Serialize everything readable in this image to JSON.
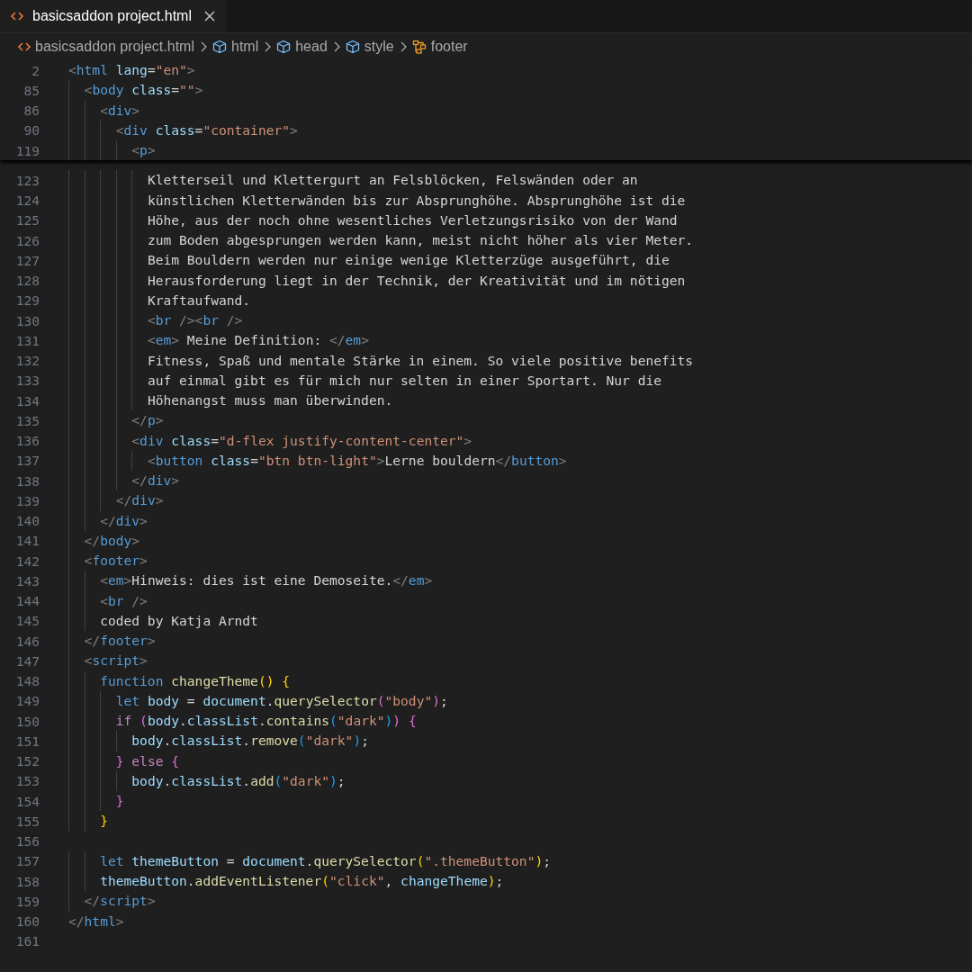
{
  "tabs": [
    {
      "label": "basicsaddon project.html",
      "selected": true
    }
  ],
  "breadcrumbs": [
    {
      "kind": "file",
      "label": "basicsaddon project.html"
    },
    {
      "kind": "element",
      "label": "html"
    },
    {
      "kind": "element",
      "label": "head"
    },
    {
      "kind": "element",
      "label": "style"
    },
    {
      "kind": "structure",
      "label": "footer"
    }
  ],
  "sticky_lines": [
    {
      "number": "2",
      "tokens": [
        {
          "kind": "punct",
          "text": "<"
        },
        {
          "kind": "tag",
          "text": "html"
        },
        {
          "kind": "attr",
          "text": " lang"
        },
        {
          "kind": "plain",
          "text": "="
        },
        {
          "kind": "string",
          "text": "\"en\""
        },
        {
          "kind": "punct",
          "text": ">"
        }
      ]
    },
    {
      "number": "85",
      "tokens": [
        {
          "kind": "punct",
          "text": "  <"
        },
        {
          "kind": "tag",
          "text": "body"
        },
        {
          "kind": "attr",
          "text": " class"
        },
        {
          "kind": "plain",
          "text": "="
        },
        {
          "kind": "string",
          "text": "\"\""
        },
        {
          "kind": "punct",
          "text": ">"
        }
      ]
    },
    {
      "number": "86",
      "tokens": [
        {
          "kind": "punct",
          "text": "    <"
        },
        {
          "kind": "tag",
          "text": "div"
        },
        {
          "kind": "punct",
          "text": ">"
        }
      ]
    },
    {
      "number": "90",
      "tokens": [
        {
          "kind": "punct",
          "text": "      <"
        },
        {
          "kind": "tag",
          "text": "div"
        },
        {
          "kind": "attr",
          "text": " class"
        },
        {
          "kind": "plain",
          "text": "="
        },
        {
          "kind": "string",
          "text": "\"container\""
        },
        {
          "kind": "punct",
          "text": ">"
        }
      ]
    },
    {
      "number": "119",
      "tokens": [
        {
          "kind": "punct",
          "text": "        <"
        },
        {
          "kind": "tag",
          "text": "p"
        },
        {
          "kind": "punct",
          "text": ">"
        }
      ]
    }
  ],
  "lines": [
    {
      "number": "123",
      "tokens": [
        {
          "kind": "plain",
          "text": "          Kletterseil und Klettergurt an Felsblöcken, Felswänden oder an"
        }
      ]
    },
    {
      "number": "124",
      "tokens": [
        {
          "kind": "plain",
          "text": "          künstlichen Kletterwänden bis zur Absprunghöhe. Absprunghöhe ist die"
        }
      ]
    },
    {
      "number": "125",
      "tokens": [
        {
          "kind": "plain",
          "text": "          Höhe, aus der noch ohne wesentliches Verletzungsrisiko von der Wand"
        }
      ]
    },
    {
      "number": "126",
      "tokens": [
        {
          "kind": "plain",
          "text": "          zum Boden abgesprungen werden kann, meist nicht höher als vier Meter."
        }
      ]
    },
    {
      "number": "127",
      "tokens": [
        {
          "kind": "plain",
          "text": "          Beim Bouldern werden nur einige wenige Kletterzüge ausgeführt, die"
        }
      ]
    },
    {
      "number": "128",
      "tokens": [
        {
          "kind": "plain",
          "text": "          Herausforderung liegt in der Technik, der Kreativität und im nötigen"
        }
      ]
    },
    {
      "number": "129",
      "tokens": [
        {
          "kind": "plain",
          "text": "          Kraftaufwand."
        }
      ]
    },
    {
      "number": "130",
      "tokens": [
        {
          "kind": "punct",
          "text": "          <"
        },
        {
          "kind": "tag",
          "text": "br"
        },
        {
          "kind": "punct",
          "text": " /><"
        },
        {
          "kind": "tag",
          "text": "br"
        },
        {
          "kind": "punct",
          "text": " />"
        }
      ]
    },
    {
      "number": "131",
      "tokens": [
        {
          "kind": "punct",
          "text": "          <"
        },
        {
          "kind": "tag",
          "text": "em"
        },
        {
          "kind": "punct",
          "text": ">"
        },
        {
          "kind": "plain",
          "text": " Meine Definition: "
        },
        {
          "kind": "punct",
          "text": "</"
        },
        {
          "kind": "tag",
          "text": "em"
        },
        {
          "kind": "punct",
          "text": ">"
        }
      ]
    },
    {
      "number": "132",
      "tokens": [
        {
          "kind": "plain",
          "text": "          Fitness, Spaß und mentale Stärke in einem. So viele positive benefits"
        }
      ]
    },
    {
      "number": "133",
      "tokens": [
        {
          "kind": "plain",
          "text": "          auf einmal gibt es für mich nur selten in einer Sportart. Nur die"
        }
      ]
    },
    {
      "number": "134",
      "tokens": [
        {
          "kind": "plain",
          "text": "          Höhenangst muss man überwinden."
        }
      ]
    },
    {
      "number": "135",
      "tokens": [
        {
          "kind": "punct",
          "text": "        </"
        },
        {
          "kind": "tag",
          "text": "p"
        },
        {
          "kind": "punct",
          "text": ">"
        }
      ]
    },
    {
      "number": "136",
      "tokens": [
        {
          "kind": "punct",
          "text": "        <"
        },
        {
          "kind": "tag",
          "text": "div"
        },
        {
          "kind": "attr",
          "text": " class"
        },
        {
          "kind": "plain",
          "text": "="
        },
        {
          "kind": "string",
          "text": "\"d-flex justify-content-center\""
        },
        {
          "kind": "punct",
          "text": ">"
        }
      ]
    },
    {
      "number": "137",
      "tokens": [
        {
          "kind": "punct",
          "text": "          <"
        },
        {
          "kind": "tag",
          "text": "button"
        },
        {
          "kind": "attr",
          "text": " class"
        },
        {
          "kind": "plain",
          "text": "="
        },
        {
          "kind": "string",
          "text": "\"btn btn-light\""
        },
        {
          "kind": "punct",
          "text": ">"
        },
        {
          "kind": "plain",
          "text": "Lerne bouldern"
        },
        {
          "kind": "punct",
          "text": "</"
        },
        {
          "kind": "tag",
          "text": "button"
        },
        {
          "kind": "punct",
          "text": ">"
        }
      ]
    },
    {
      "number": "138",
      "tokens": [
        {
          "kind": "punct",
          "text": "        </"
        },
        {
          "kind": "tag",
          "text": "div"
        },
        {
          "kind": "punct",
          "text": ">"
        }
      ]
    },
    {
      "number": "139",
      "tokens": [
        {
          "kind": "punct",
          "text": "      </"
        },
        {
          "kind": "tag",
          "text": "div"
        },
        {
          "kind": "punct",
          "text": ">"
        }
      ]
    },
    {
      "number": "140",
      "tokens": [
        {
          "kind": "punct",
          "text": "    </"
        },
        {
          "kind": "tag",
          "text": "div"
        },
        {
          "kind": "punct",
          "text": ">"
        }
      ]
    },
    {
      "number": "141",
      "tokens": [
        {
          "kind": "punct",
          "text": "  </"
        },
        {
          "kind": "tag",
          "text": "body"
        },
        {
          "kind": "punct",
          "text": ">"
        }
      ]
    },
    {
      "number": "142",
      "tokens": [
        {
          "kind": "punct",
          "text": "  <"
        },
        {
          "kind": "tag",
          "text": "footer"
        },
        {
          "kind": "punct",
          "text": ">"
        }
      ]
    },
    {
      "number": "143",
      "tokens": [
        {
          "kind": "punct",
          "text": "    <"
        },
        {
          "kind": "tag",
          "text": "em"
        },
        {
          "kind": "punct",
          "text": ">"
        },
        {
          "kind": "plain",
          "text": "Hinweis: dies ist eine Demoseite."
        },
        {
          "kind": "punct",
          "text": "</"
        },
        {
          "kind": "tag",
          "text": "em"
        },
        {
          "kind": "punct",
          "text": ">"
        }
      ]
    },
    {
      "number": "144",
      "tokens": [
        {
          "kind": "punct",
          "text": "    <"
        },
        {
          "kind": "tag",
          "text": "br"
        },
        {
          "kind": "punct",
          "text": " />"
        }
      ]
    },
    {
      "number": "145",
      "tokens": [
        {
          "kind": "plain",
          "text": "    coded by Katja Arndt"
        }
      ]
    },
    {
      "number": "146",
      "tokens": [
        {
          "kind": "punct",
          "text": "  </"
        },
        {
          "kind": "tag",
          "text": "footer"
        },
        {
          "kind": "punct",
          "text": ">"
        }
      ]
    },
    {
      "number": "147",
      "tokens": [
        {
          "kind": "punct",
          "text": "  <"
        },
        {
          "kind": "tag",
          "text": "script"
        },
        {
          "kind": "punct",
          "text": ">"
        }
      ]
    },
    {
      "number": "148",
      "tokens": [
        {
          "kind": "keyword",
          "text": "    function"
        },
        {
          "kind": "function",
          "text": " changeTheme"
        },
        {
          "kind": "bracket1",
          "text": "()"
        },
        {
          "kind": "bracket1",
          "text": " {"
        }
      ]
    },
    {
      "number": "149",
      "tokens": [
        {
          "kind": "keyword",
          "text": "      let"
        },
        {
          "kind": "variable",
          "text": " body"
        },
        {
          "kind": "plain",
          "text": " = "
        },
        {
          "kind": "variable",
          "text": "document"
        },
        {
          "kind": "plain",
          "text": "."
        },
        {
          "kind": "function",
          "text": "querySelector"
        },
        {
          "kind": "bracket2",
          "text": "("
        },
        {
          "kind": "string",
          "text": "\"body\""
        },
        {
          "kind": "bracket2",
          "text": ")"
        },
        {
          "kind": "plain",
          "text": ";"
        }
      ]
    },
    {
      "number": "150",
      "tokens": [
        {
          "kind": "control",
          "text": "      if"
        },
        {
          "kind": "bracket2",
          "text": " ("
        },
        {
          "kind": "variable",
          "text": "body"
        },
        {
          "kind": "plain",
          "text": "."
        },
        {
          "kind": "variable",
          "text": "classList"
        },
        {
          "kind": "plain",
          "text": "."
        },
        {
          "kind": "function",
          "text": "contains"
        },
        {
          "kind": "bracket3",
          "text": "("
        },
        {
          "kind": "string",
          "text": "\"dark\""
        },
        {
          "kind": "bracket3",
          "text": ")"
        },
        {
          "kind": "bracket2",
          "text": ")"
        },
        {
          "kind": "bracket2",
          "text": " {"
        }
      ]
    },
    {
      "number": "151",
      "tokens": [
        {
          "kind": "variable",
          "text": "        body"
        },
        {
          "kind": "plain",
          "text": "."
        },
        {
          "kind": "variable",
          "text": "classList"
        },
        {
          "kind": "plain",
          "text": "."
        },
        {
          "kind": "function",
          "text": "remove"
        },
        {
          "kind": "bracket3",
          "text": "("
        },
        {
          "kind": "string",
          "text": "\"dark\""
        },
        {
          "kind": "bracket3",
          "text": ")"
        },
        {
          "kind": "plain",
          "text": ";"
        }
      ]
    },
    {
      "number": "152",
      "tokens": [
        {
          "kind": "bracket2",
          "text": "      }"
        },
        {
          "kind": "control",
          "text": " else"
        },
        {
          "kind": "bracket2",
          "text": " {"
        }
      ]
    },
    {
      "number": "153",
      "tokens": [
        {
          "kind": "variable",
          "text": "        body"
        },
        {
          "kind": "plain",
          "text": "."
        },
        {
          "kind": "variable",
          "text": "classList"
        },
        {
          "kind": "plain",
          "text": "."
        },
        {
          "kind": "function",
          "text": "add"
        },
        {
          "kind": "bracket3",
          "text": "("
        },
        {
          "kind": "string",
          "text": "\"dark\""
        },
        {
          "kind": "bracket3",
          "text": ")"
        },
        {
          "kind": "plain",
          "text": ";"
        }
      ]
    },
    {
      "number": "154",
      "tokens": [
        {
          "kind": "bracket2",
          "text": "      }"
        }
      ]
    },
    {
      "number": "155",
      "tokens": [
        {
          "kind": "bracket1",
          "text": "    }"
        }
      ]
    },
    {
      "number": "156"
    },
    {
      "number": "157",
      "tokens": [
        {
          "kind": "keyword",
          "text": "    let"
        },
        {
          "kind": "variable",
          "text": " themeButton"
        },
        {
          "kind": "plain",
          "text": " = "
        },
        {
          "kind": "variable",
          "text": "document"
        },
        {
          "kind": "plain",
          "text": "."
        },
        {
          "kind": "function",
          "text": "querySelector"
        },
        {
          "kind": "bracket1",
          "text": "("
        },
        {
          "kind": "string",
          "text": "\".themeButton\""
        },
        {
          "kind": "bracket1",
          "text": ")"
        },
        {
          "kind": "plain",
          "text": ";"
        }
      ]
    },
    {
      "number": "158",
      "tokens": [
        {
          "kind": "variable",
          "text": "    themeButton"
        },
        {
          "kind": "plain",
          "text": "."
        },
        {
          "kind": "function",
          "text": "addEventListener"
        },
        {
          "kind": "bracket1",
          "text": "("
        },
        {
          "kind": "string",
          "text": "\"click\""
        },
        {
          "kind": "plain",
          "text": ", "
        },
        {
          "kind": "variable",
          "text": "changeTheme"
        },
        {
          "kind": "bracket1",
          "text": ")"
        },
        {
          "kind": "plain",
          "text": ";"
        }
      ]
    },
    {
      "number": "159",
      "tokens": [
        {
          "kind": "punct",
          "text": "  </"
        },
        {
          "kind": "tag",
          "text": "script"
        },
        {
          "kind": "punct",
          "text": ">"
        }
      ]
    },
    {
      "number": "160",
      "tokens": [
        {
          "kind": "punct",
          "text": "</"
        },
        {
          "kind": "tag",
          "text": "html"
        },
        {
          "kind": "punct",
          "text": ">"
        }
      ]
    },
    {
      "number": "161"
    }
  ]
}
